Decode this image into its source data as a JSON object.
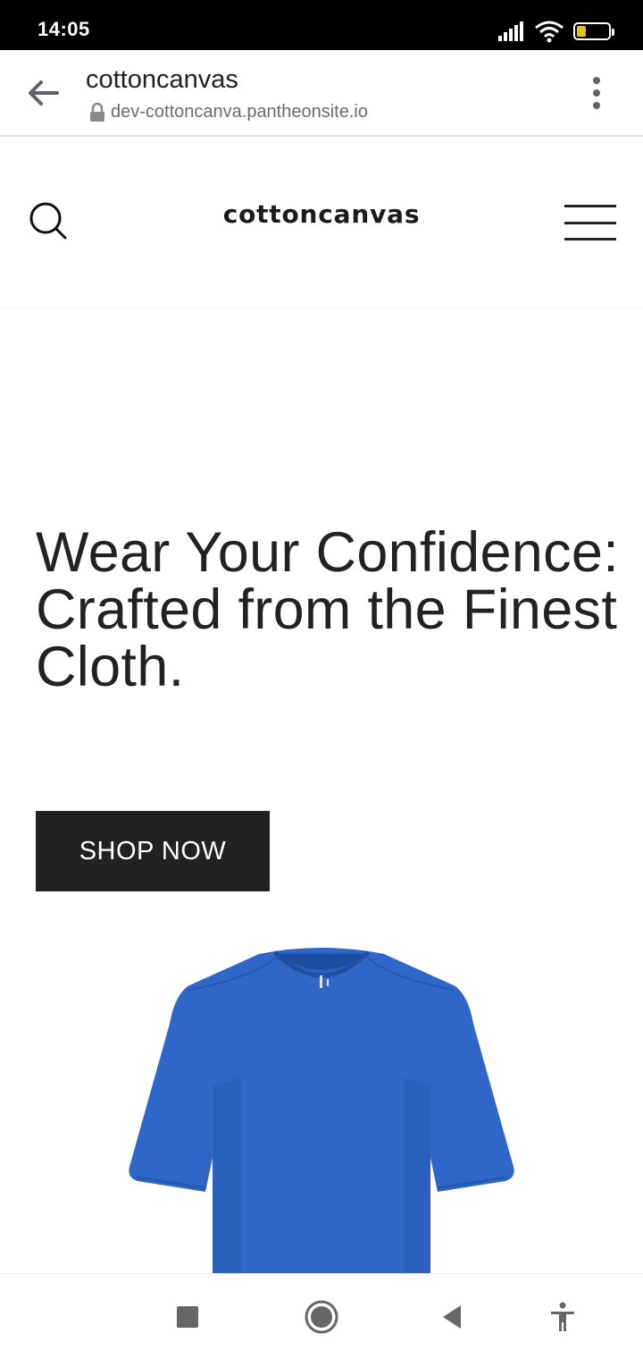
{
  "status_bar": {
    "time": "14:05",
    "battery_level": "38",
    "battery_percent": 38,
    "icons": [
      "signal-icon",
      "wifi-icon",
      "battery-icon"
    ]
  },
  "browser": {
    "title": "cottoncanvas",
    "url": "dev-cottoncanva.pantheonsite.io",
    "icons": [
      "back-arrow-icon",
      "lock-icon",
      "more-vert-icon"
    ]
  },
  "site": {
    "logo": "cottoncanvas",
    "icons": [
      "search-icon",
      "hamburger-menu-icon"
    ]
  },
  "hero": {
    "heading": "Wear Your Confidence: Crafted from the Finest Cloth.",
    "button_label": "SHOP NOW",
    "image": "blue-tshirt-image",
    "shirt_color": "#2f67c8"
  },
  "nav": {
    "icons": [
      "recents-square-icon",
      "home-circle-icon",
      "back-triangle-icon",
      "accessibility-icon"
    ]
  },
  "colors": {
    "accent_dark": "#222222",
    "battery_fill": "#e6c21a",
    "text_gray": "#6b6b6b"
  }
}
